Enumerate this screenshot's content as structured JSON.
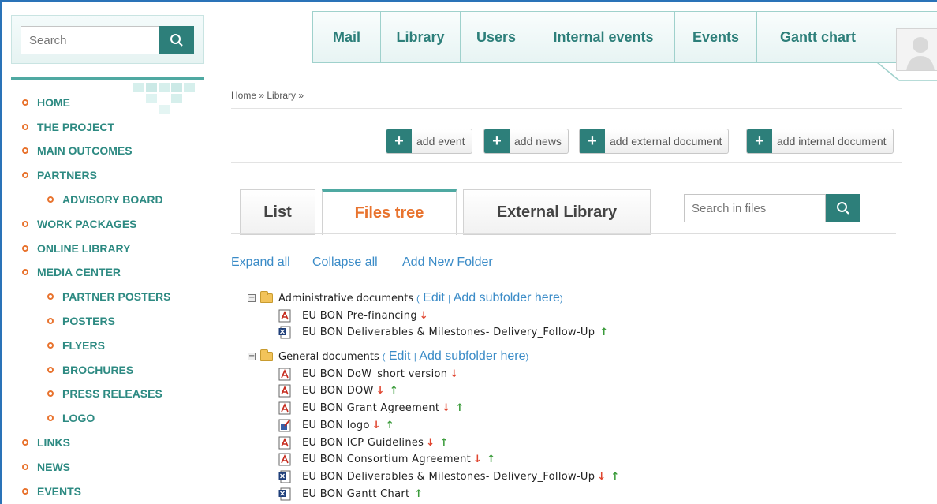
{
  "search": {
    "placeholder": "Search"
  },
  "sidebar": {
    "items": [
      {
        "label": "HOME"
      },
      {
        "label": "THE PROJECT"
      },
      {
        "label": "MAIN OUTCOMES"
      },
      {
        "label": "PARTNERS"
      },
      {
        "label": "ADVISORY BOARD"
      },
      {
        "label": "WORK PACKAGES"
      },
      {
        "label": "ONLINE LIBRARY"
      },
      {
        "label": "MEDIA CENTER"
      },
      {
        "label": "PARTNER POSTERS"
      },
      {
        "label": "POSTERS"
      },
      {
        "label": "FLYERS"
      },
      {
        "label": "BROCHURES"
      },
      {
        "label": "PRESS RELEASES"
      },
      {
        "label": "LOGO"
      },
      {
        "label": "LINKS"
      },
      {
        "label": "NEWS"
      },
      {
        "label": "EVENTS"
      }
    ]
  },
  "topnav": {
    "tabs": [
      {
        "label": "Mail"
      },
      {
        "label": "Library"
      },
      {
        "label": "Users"
      },
      {
        "label": "Internal events"
      },
      {
        "label": "Events"
      },
      {
        "label": "Gantt chart"
      }
    ]
  },
  "breadcrumb": "Home » Library »",
  "actions": [
    {
      "label": "add event"
    },
    {
      "label": "add news"
    },
    {
      "label": "add external document"
    },
    {
      "label": "add internal document"
    }
  ],
  "view_tabs": [
    {
      "label": "List"
    },
    {
      "label": "Files tree"
    },
    {
      "label": "External Library"
    }
  ],
  "files_search": {
    "placeholder": "Search in files"
  },
  "tree_actions": {
    "expand": "Expand all",
    "collapse": "Collapse all",
    "add_folder": "Add New Folder"
  },
  "folders": [
    {
      "name": "Administrative documents",
      "edit": "Edit",
      "add_sub": "Add subfolder here",
      "files": [
        {
          "name": "EU BON Pre-financing",
          "icon": "pdf-icon",
          "down": "↓",
          "up": ""
        },
        {
          "name": "EU BON Deliverables & Milestones- Delivery_Follow-Up",
          "icon": "xls-icon",
          "down": "",
          "up": "↑"
        }
      ]
    },
    {
      "name": "General documents",
      "edit": "Edit",
      "add_sub": "Add subfolder here",
      "files": [
        {
          "name": "EU BON DoW_short version",
          "icon": "pdf-icon",
          "down": "↓",
          "up": ""
        },
        {
          "name": "EU BON DOW",
          "icon": "pdf-icon",
          "down": "↓",
          "up": "↑"
        },
        {
          "name": "EU BON Grant Agreement",
          "icon": "pdf-icon",
          "down": "↓",
          "up": "↑"
        },
        {
          "name": "EU BON logo",
          "icon": "image-icon",
          "down": "↓",
          "up": "↑"
        },
        {
          "name": "EU BON ICP Guidelines",
          "icon": "pdf-icon",
          "down": "↓",
          "up": "↑"
        },
        {
          "name": "EU BON Consortium Agreement",
          "icon": "pdf-icon",
          "down": "↓",
          "up": "↑"
        },
        {
          "name": "EU BON Deliverables & Milestones- Delivery_Follow-Up",
          "icon": "xls-icon",
          "down": "↓",
          "up": "↑"
        },
        {
          "name": "EU BON Gantt Chart",
          "icon": "xls-icon",
          "down": "",
          "up": "↑"
        }
      ]
    }
  ],
  "colors": {
    "teal": "#2d7f7a",
    "orange": "#e8732e",
    "link": "#3a8bc7"
  }
}
